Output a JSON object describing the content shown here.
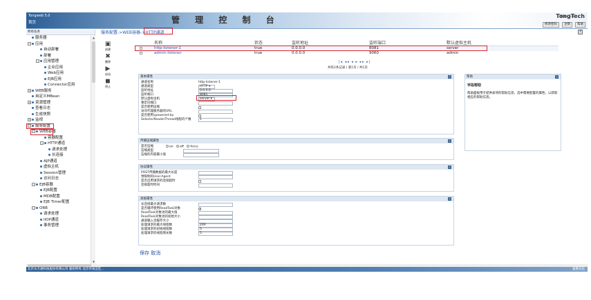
{
  "header": {
    "app_name": "Tongweb 5.0",
    "home": "首页",
    "title": "管 理 控 制 台",
    "brand": "TongTech",
    "version": "版本: 5.0",
    "links": [
      "修改密码",
      "注销",
      "帮助"
    ]
  },
  "left": {
    "title": "所有任务",
    "tree": [
      {
        "label": "服务器",
        "indent": 1,
        "kind": "dot"
      },
      {
        "label": "应用",
        "indent": 0,
        "kind": "tog",
        "sign": "−"
      },
      {
        "label": "自动部署",
        "indent": 3,
        "kind": "dot"
      },
      {
        "label": "部署",
        "indent": 3,
        "kind": "dot"
      },
      {
        "label": "应用管理",
        "indent": 2,
        "kind": "tog",
        "sign": "−"
      },
      {
        "label": "企业应用",
        "indent": 4,
        "kind": "dot"
      },
      {
        "label": "Web应用",
        "indent": 4,
        "kind": "dot"
      },
      {
        "label": "EJB应用",
        "indent": 4,
        "kind": "dot"
      },
      {
        "label": "Connector应用",
        "indent": 4,
        "kind": "dot"
      },
      {
        "label": "WEB服务",
        "indent": 0,
        "kind": "tog",
        "sign": "+"
      },
      {
        "label": "自定义MBean",
        "indent": 1,
        "kind": "dot"
      },
      {
        "label": "资源管理",
        "indent": 0,
        "kind": "tog",
        "sign": "+"
      },
      {
        "label": "查看日志",
        "indent": 1,
        "kind": "dot"
      },
      {
        "label": "生成快照",
        "indent": 1,
        "kind": "dot"
      },
      {
        "label": "监视",
        "indent": 0,
        "kind": "tog",
        "sign": "+"
      },
      {
        "label": "服务配置",
        "indent": 0,
        "kind": "tog",
        "sign": "−",
        "boxed": true
      },
      {
        "label": "WEB容器",
        "indent": 1,
        "kind": "tog",
        "sign": "−",
        "boxed": true
      },
      {
        "label": "容器配置",
        "indent": 4,
        "kind": "dot"
      },
      {
        "label": "HTTP通道",
        "indent": 3,
        "kind": "tog",
        "sign": "−"
      },
      {
        "label": "请求处理",
        "indent": 5,
        "kind": "dot"
      },
      {
        "label": "长连接",
        "indent": 5,
        "kind": "dot"
      },
      {
        "label": "AJP通道",
        "indent": 3,
        "kind": "dot"
      },
      {
        "label": "虚拟主机",
        "indent": 3,
        "kind": "dot"
      },
      {
        "label": "Session管理",
        "indent": 3,
        "kind": "dot"
      },
      {
        "label": "访问日志",
        "indent": 3,
        "kind": "dot"
      },
      {
        "label": "EJB容器",
        "indent": 1,
        "kind": "tog",
        "sign": "−"
      },
      {
        "label": "EJB配置",
        "indent": 3,
        "kind": "dot"
      },
      {
        "label": "MDB配置",
        "indent": 3,
        "kind": "dot"
      },
      {
        "label": "EJB Timer配置",
        "indent": 3,
        "kind": "dot"
      },
      {
        "label": "ORB",
        "indent": 1,
        "kind": "tog",
        "sign": "−"
      },
      {
        "label": "请求处理",
        "indent": 3,
        "kind": "dot"
      },
      {
        "label": "IIOP通道",
        "indent": 3,
        "kind": "dot"
      },
      {
        "label": "事务管理",
        "indent": 3,
        "kind": "dot"
      }
    ]
  },
  "breadcrumb": "服务配置->WEB容器->HTTP通道",
  "actions": [
    {
      "icon": "create-icon",
      "glyph": "▣",
      "label": "创建"
    },
    {
      "icon": "delete-icon",
      "glyph": "✖",
      "label": "删除"
    },
    {
      "icon": "start-icon",
      "glyph": "▶",
      "label": "启动"
    },
    {
      "icon": "stop-icon",
      "glyph": "◼",
      "label": "停止"
    }
  ],
  "listeners": {
    "columns": [
      "名称",
      "状态",
      "监听地址",
      "监听端口",
      "默认虚拟主机"
    ],
    "rows": [
      {
        "name": "http-listener-1",
        "status": "true",
        "address": "0.0.0.0",
        "port": "8081",
        "host": "server"
      },
      {
        "name": "admin-listener",
        "status": "true",
        "address": "0.0.0.0",
        "port": "9060",
        "host": "admin"
      }
    ],
    "pager": "|◂ ◂◂ ◂ ▸ ▸▸ ▸|",
    "pager_text": "共有2条记录 | 第1页 / 共1页"
  },
  "basic": {
    "title": "基本属性",
    "props": [
      {
        "k": "通道名称",
        "v": "http-listener-1",
        "type": "text"
      },
      {
        "k": "通道类型",
        "v": "HTTP ▾",
        "type": "select"
      },
      {
        "k": "监听地址",
        "v": "0.0.0.0",
        "type": "input"
      },
      {
        "k": "监听端口",
        "v": "8081",
        "type": "input"
      },
      {
        "k": "默认虚拟主机",
        "v": "server ▾",
        "type": "select"
      },
      {
        "k": "重定向端口",
        "v": "",
        "type": "input"
      },
      {
        "k": "是否使用压缩",
        "v": "",
        "type": "checkbox"
      },
      {
        "k": "访问代理服务器的URL",
        "v": "",
        "type": "input"
      },
      {
        "k": "是否使用xpowered-by",
        "v": "",
        "type": "checkbox"
      },
      {
        "k": "SelectorReaderThread线程的个数",
        "v": "1",
        "type": "input"
      }
    ]
  },
  "compress": {
    "title": "传输压缩属性",
    "mode_label": "是否压缩",
    "options": [
      "on",
      "off",
      "force"
    ],
    "type_label": "压缩类型",
    "min_label": "压缩的内容最小值"
  },
  "limits": {
    "title": "协议属性",
    "props": [
      {
        "k": "POST传输数据的最大长度",
        "v": "",
        "type": "input"
      },
      {
        "k": "预限制的User-Agent",
        "v": "",
        "type": "input"
      },
      {
        "k": "是否启用请求的连接超时",
        "v": "",
        "type": "checkbox"
      },
      {
        "k": "连接超时时间",
        "v": "",
        "type": "input"
      }
    ]
  },
  "advanced": {
    "title": "高级属性",
    "props": [
      {
        "k": "长连接最大请求数",
        "v": "",
        "type": "input"
      },
      {
        "k": "是否循环使用ReadTask对象",
        "v": "",
        "type": "checkbox-on"
      },
      {
        "k": "ReadTask对象池的最大值",
        "v": "",
        "type": "input"
      },
      {
        "k": "ReadTask对象池的初始大小",
        "v": "",
        "type": "input"
      },
      {
        "k": "通道输入流缓存大小",
        "v": "",
        "type": "input"
      },
      {
        "k": "处理请求的最大线程数",
        "v": "200",
        "type": "input"
      },
      {
        "k": "处理请求的初始线程数",
        "v": "5",
        "type": "input"
      },
      {
        "k": "处理请求的线程增长数",
        "v": "5",
        "type": "input"
      }
    ]
  },
  "save": "保存 取消",
  "help": {
    "title": "帮助",
    "subtitle": "字段帮助",
    "body": "帮助面板用于提供表项的帮助信息，选中需要配置的属性，以获取相应的帮助信息。"
  },
  "status": {
    "left": "北京东方通科技股份有限公司  版权所有   北京市海淀区...",
    "right": "查看日志"
  }
}
